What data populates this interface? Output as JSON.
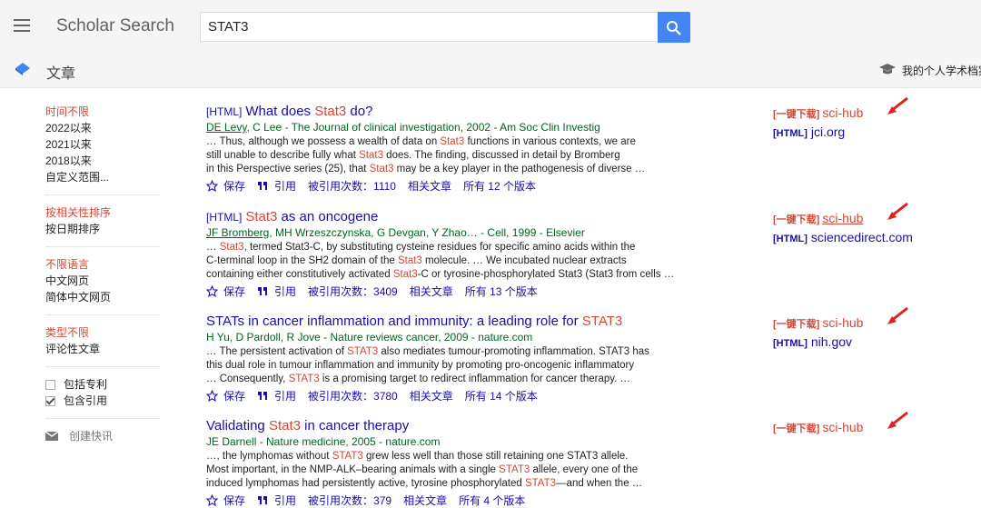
{
  "header": {
    "app_title": "Scholar Search",
    "search_value": "STAT3"
  },
  "subbar": {
    "section": "文章",
    "profile": "我的个人学术档案"
  },
  "sidebar": {
    "time": [
      "时间不限",
      "2022以来",
      "2021以来",
      "2018以来",
      "自定义范围..."
    ],
    "sort": [
      "按相关性排序",
      "按日期排序"
    ],
    "lang": [
      "不限语言",
      "中文网页",
      "简体中文网页"
    ],
    "type": [
      "类型不限",
      "评论性文章"
    ],
    "checks": [
      {
        "label": "包括专利",
        "checked": false
      },
      {
        "label": "包含引用",
        "checked": true
      }
    ],
    "alert": "创建快讯"
  },
  "actions": {
    "save": "保存",
    "cite": "引用",
    "related": "相关文章"
  },
  "results": [
    {
      "tag": "[HTML]",
      "title_pre": "What does ",
      "title_hl": "Stat3",
      "title_post": " do?",
      "author_link": "DE Levy",
      "meta_rest": ", C Lee - The Journal of clinical investigation, 2002 - Am Soc Clin Investig",
      "snippets": [
        [
          "… Thus, although we possess a wealth of data on ",
          "Stat3",
          " functions in various contexts, we are"
        ],
        [
          "still unable to describe fully what ",
          "Stat3",
          " does. The finding, discussed in detail by Bromberg"
        ],
        [
          "in this Perspective series (25), that ",
          "Stat3",
          " may be a key player in the pathogenesis of diverse …"
        ]
      ],
      "cited": "被引用次数：1110",
      "versions": "所有 12 个版本",
      "dl_tag": "[一键下载]",
      "dl_name": "sci-hub",
      "html_tag": "[HTML]",
      "html_site": "jci.org"
    },
    {
      "tag": "[HTML]",
      "title_pre": "",
      "title_hl": "Stat3",
      "title_post": " as an oncogene",
      "author_link": "JF Bromberg",
      "meta_rest": ", MH Wrzeszczynska, G Devgan, Y Zhao… - Cell, 1999 - Elsevier",
      "snippets": [
        [
          "… ",
          "Stat3",
          ", termed Stat3-C, by substituting cysteine residues for specific amino acids within the"
        ],
        [
          "C-terminal loop in the SH2 domain of the ",
          "Stat3",
          " molecule. … We incubated nuclear extracts"
        ],
        [
          "containing either constitutively activated ",
          "Stat3",
          "-C or tyrosine-phosphorylated Stat3 (Stat3 from cells …"
        ]
      ],
      "cited": "被引用次数：3409",
      "versions": "所有 13 个版本",
      "dl_tag": "[一键下载]",
      "dl_name": "sci-hub",
      "html_tag": "[HTML]",
      "html_site": "sciencedirect.com"
    },
    {
      "tag": "",
      "title_pre": "STATs in cancer inflammation and immunity: a leading role for ",
      "title_hl": "STAT3",
      "title_post": "",
      "author_link": "",
      "meta_rest": "H Yu, D Pardoll, R Jove - Nature reviews cancer, 2009 - nature.com",
      "snippets": [
        [
          "… The persistent activation of ",
          "STAT3",
          " also mediates tumour-promoting inflammation. STAT3 has"
        ],
        [
          "this dual role in tumour inflammation and immunity by promoting pro-oncogenic inflammatory",
          "",
          ""
        ],
        [
          "… Consequently, ",
          "STAT3",
          " is a promising target to redirect inflammation for cancer therapy. …"
        ]
      ],
      "cited": "被引用次数：3780",
      "versions": "所有 14 个版本",
      "dl_tag": "[一键下载]",
      "dl_name": "sci-hub",
      "html_tag": "[HTML]",
      "html_site": "nih.gov"
    },
    {
      "tag": "",
      "title_pre": "Validating ",
      "title_hl": "Stat3",
      "title_post": " in cancer therapy",
      "author_link": "",
      "meta_rest": "JE Darnell - Nature medicine, 2005 - nature.com",
      "snippets": [
        [
          "…, the lymphomas without ",
          "STAT3",
          " grew less well than those still retaining one STAT3 allele."
        ],
        [
          "Most important, in the NMP-ALK–bearing animals with a single ",
          "STAT3",
          " allele, every one of the"
        ],
        [
          "induced lymphomas had persistently active, tyrosine phosphorylated ",
          "STAT3",
          "—and when the …"
        ]
      ],
      "cited": "被引用次数：379",
      "versions": "所有 4 个版本",
      "dl_tag": "[一键下载]",
      "dl_name": "sci-hub",
      "html_tag": "",
      "html_site": ""
    }
  ]
}
